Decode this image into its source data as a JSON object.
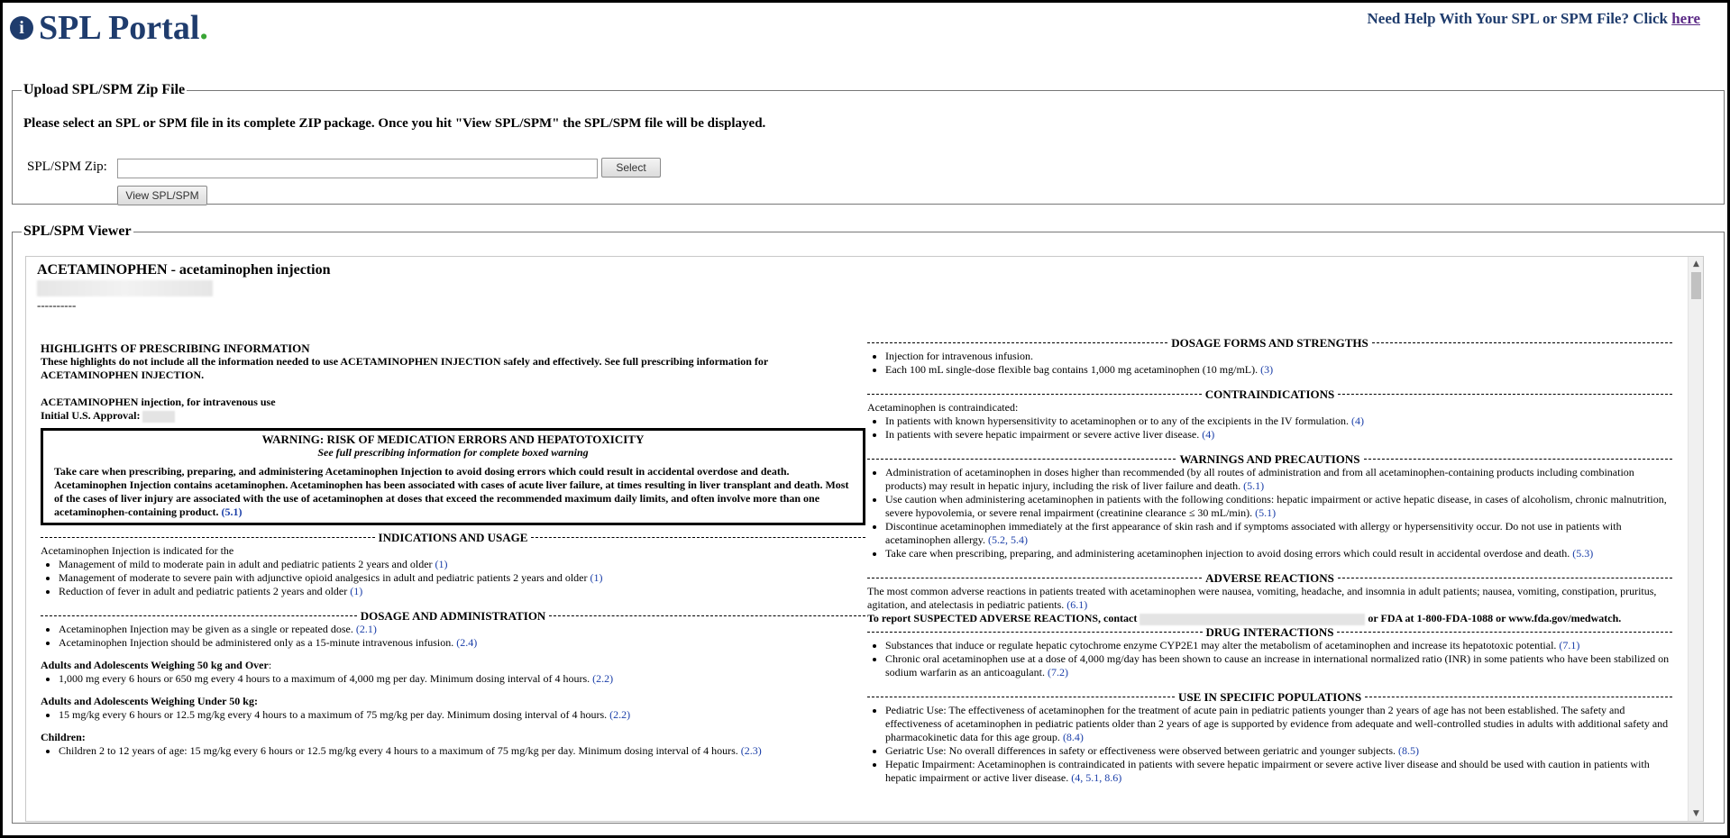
{
  "header": {
    "logo_mark": "i",
    "logo_text": "SPL Portal",
    "logo_dot": ".",
    "help_text": "Need Help With Your SPL or SPM File? Click ",
    "help_link": "here"
  },
  "upload": {
    "legend": "Upload SPL/SPM Zip File",
    "instructions": "Please select an SPL or SPM file in its complete ZIP package. Once you hit \"View SPL/SPM\" the SPL/SPM file will be displayed.",
    "zip_label": "SPL/SPM Zip:",
    "zip_value": "",
    "select_button": "Select",
    "view_button": "View SPL/SPM"
  },
  "viewer": {
    "legend": "SPL/SPM Viewer",
    "doc_title": "ACETAMINOPHEN - acetaminophen injection",
    "dashes": "----------",
    "highlights": {
      "title": "HIGHLIGHTS OF PRESCRIBING INFORMATION",
      "intro": "These highlights do not include all the information needed to use ACETAMINOPHEN INJECTION safely and effectively. See full prescribing information for ACETAMINOPHEN INJECTION.",
      "product_line": "ACETAMINOPHEN injection, for intravenous use",
      "approval_label": "Initial U.S. Approval:"
    },
    "warning": {
      "title": "WARNING: RISK OF MEDICATION ERRORS AND HEPATOTOXICITY",
      "subtitle": "See full prescribing information for complete boxed warning",
      "p1": "Take care when prescribing, preparing, and administering Acetaminophen Injection to avoid dosing errors which could result in accidental overdose and death.",
      "p2": "Acetaminophen Injection contains acetaminophen. Acetaminophen has been associated with cases of acute liver failure, at times resulting in liver transplant and death. Most of the cases of liver injury are associated with the use of acetaminophen at doses that exceed the recommended maximum daily limits, and often involve more than one acetaminophen-containing product. ",
      "p2_ref": "(5.1)"
    },
    "indications": {
      "heading": "INDICATIONS AND USAGE",
      "intro": "Acetaminophen Injection is indicated for the",
      "items": [
        {
          "text": "Management of mild to moderate pain in adult and pediatric patients 2 years and older ",
          "ref": "(1)"
        },
        {
          "text": "Management of moderate to severe pain with adjunctive opioid analgesics in adult and pediatric patients 2 years and older ",
          "ref": "(1)"
        },
        {
          "text": "Reduction of fever in adult and pediatric patients 2 years and older ",
          "ref": "(1)"
        }
      ]
    },
    "dosage": {
      "heading": "DOSAGE AND ADMINISTRATION",
      "items": [
        {
          "text": "Acetaminophen Injection may be given as a single or repeated dose. ",
          "ref": "(2.1)"
        },
        {
          "text": "Acetaminophen Injection should be administered only as a 15-minute intravenous infusion. ",
          "ref": "(2.4)"
        }
      ],
      "sub1": "Adults and Adolescents Weighing 50 kg and Over",
      "sub1_colon": ":",
      "sub1_item": {
        "text": "1,000 mg every 6 hours or 650 mg every 4 hours to a maximum of 4,000 mg per day. Minimum dosing interval of 4 hours. ",
        "ref": "(2.2)"
      },
      "sub2": "Adults and Adolescents Weighing Under 50 kg:",
      "sub2_item": {
        "text": "15 mg/kg every 6 hours or 12.5 mg/kg every 4 hours to a maximum of 75 mg/kg per day. Minimum dosing interval of 4 hours. ",
        "ref": "(2.2)"
      },
      "sub3": "Children:",
      "sub3_item": {
        "text": "Children 2 to 12 years of age: 15 mg/kg every 6 hours or 12.5 mg/kg every 4 hours to a maximum of 75 mg/kg per day. Minimum dosing interval of 4 hours. ",
        "ref": "(2.3)"
      }
    },
    "forms": {
      "heading": "DOSAGE FORMS AND STRENGTHS",
      "items": [
        {
          "text": "Injection for intravenous infusion.",
          "ref": ""
        },
        {
          "text": "Each 100 mL single-dose flexible bag contains 1,000 mg acetaminophen (10 mg/mL). ",
          "ref": "(3)"
        }
      ]
    },
    "contra": {
      "heading": "CONTRAINDICATIONS",
      "intro": "Acetaminophen is contraindicated:",
      "items": [
        {
          "text": "In patients with known hypersensitivity to acetaminophen or to any of the excipients in the IV formulation. ",
          "ref": "(4)"
        },
        {
          "text": "In patients with severe hepatic impairment or severe active liver disease. ",
          "ref": "(4)"
        }
      ]
    },
    "warnings": {
      "heading": "WARNINGS AND PRECAUTIONS",
      "items": [
        {
          "text": "Administration of acetaminophen in doses higher than recommended (by all routes of administration and from all acetaminophen-containing products including combination products) may result in hepatic injury, including the risk of liver failure and death. ",
          "ref": "(5.1)"
        },
        {
          "text": "Use caution when administering acetaminophen in patients with the following conditions: hepatic impairment or active hepatic disease, in cases of alcoholism, chronic malnutrition, severe hypovolemia, or severe renal impairment (creatinine clearance ≤ 30 mL/min). ",
          "ref": "(5.1)"
        },
        {
          "text": "Discontinue acetaminophen immediately at the first appearance of skin rash and if symptoms associated with allergy or hypersensitivity occur. Do not use in patients with acetaminophen allergy. ",
          "ref": "(5.2, 5.4)"
        },
        {
          "text": "Take care when prescribing, preparing, and administering acetaminophen injection to avoid dosing errors which could result in accidental overdose and death. ",
          "ref": "(5.3)"
        }
      ]
    },
    "adverse": {
      "heading": "ADVERSE REACTIONS",
      "text": "The most common adverse reactions in patients treated with acetaminophen were nausea, vomiting, headache, and insomnia in adult patients; nausea, vomiting, constipation, pruritus, agitation, and atelectasis in pediatric patients. ",
      "ref": "(6.1)",
      "report_start": "To report SUSPECTED ADVERSE REACTIONS, contact",
      "report_end": "or FDA at 1-800-FDA-1088 or www.fda.gov/medwatch."
    },
    "interactions": {
      "heading": "DRUG INTERACTIONS",
      "items": [
        {
          "text": "Substances that induce or regulate hepatic cytochrome enzyme CYP2E1 may alter the metabolism of acetaminophen and increase its hepatotoxic potential. ",
          "ref": "(7.1)"
        },
        {
          "text": "Chronic oral acetaminophen use at a dose of 4,000 mg/day has been shown to cause an increase in international normalized ratio (INR) in some patients who have been stabilized on sodium warfarin as an anticoagulant. ",
          "ref": "(7.2)"
        }
      ]
    },
    "populations": {
      "heading": "USE IN SPECIFIC POPULATIONS",
      "items": [
        {
          "text": "Pediatric Use: The effectiveness of acetaminophen for the treatment of acute pain in pediatric patients younger than 2 years of age has not been established. The safety and effectiveness of acetaminophen in pediatric patients older than 2 years of age is supported by evidence from adequate and well-controlled studies in adults with additional safety and pharmacokinetic data for this age group. ",
          "ref": "(8.4)"
        },
        {
          "text": "Geriatric Use: No overall differences in safety or effectiveness were observed between geriatric and younger subjects. ",
          "ref": "(8.5)"
        },
        {
          "text": "Hepatic Impairment: Acetaminophen is contraindicated in patients with severe hepatic impairment or severe active liver disease and should be used with caution in patients with hepatic impairment or active liver disease. ",
          "ref": "(4, 5.1, 8.6)"
        }
      ]
    }
  }
}
